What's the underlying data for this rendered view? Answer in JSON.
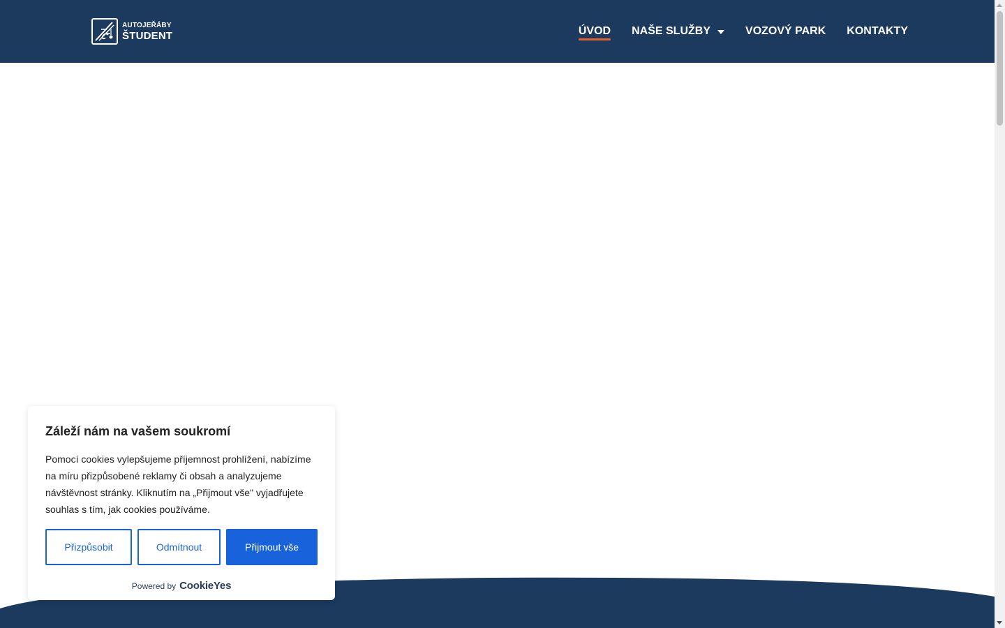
{
  "header": {
    "logo": {
      "line1": "AUTOJEŘÁBY",
      "line2": "ŠTUDENT"
    },
    "nav": [
      {
        "label": "ÚVOD",
        "active": true
      },
      {
        "label": "NAŠE SLUŽBY",
        "has_dropdown": true
      },
      {
        "label": "VOZOVÝ PARK"
      },
      {
        "label": "KONTAKTY"
      }
    ]
  },
  "cookie_banner": {
    "title": "Záleží nám na vašem soukromí",
    "text": "Pomocí cookies vylepšujeme příjemnost prohlížení, nabízíme na míru přizpůsobené reklamy či obsah a analyzujeme návštěvnost stránky. Kliknutím na „Přijmout vše\" vyjadřujete souhlas s tím, jak cookies používáme.",
    "buttons": {
      "customize": "Přizpůsobit",
      "reject": "Odmítnout",
      "accept": "Přijmout vše"
    },
    "powered_by": "Powered by",
    "brand": "CookieYes"
  },
  "colors": {
    "header_bg": "#1b3a5e",
    "nav_active_underline": "#e8612c",
    "cookie_primary": "#1863dc"
  }
}
